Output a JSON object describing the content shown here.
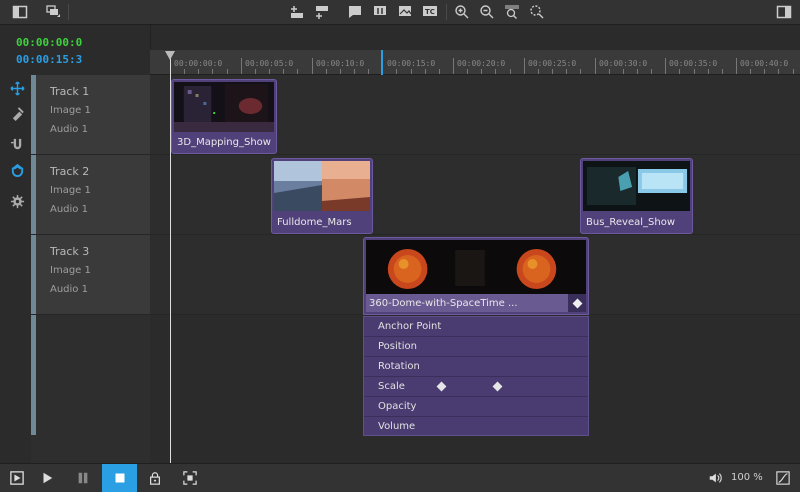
{
  "timecode": {
    "current": "00:00:00:0",
    "duration": "00:00:15:3"
  },
  "ruler": {
    "labels": [
      "00:00:00:0",
      "00:00:05:0",
      "00:00:10:0",
      "00:00:15:0",
      "00:00:20:0",
      "00:00:25:0",
      "00:00:30:0",
      "00:00:35:0",
      "00:00:40:0"
    ]
  },
  "tracks": [
    {
      "name": "Track 1",
      "image": "Image 1",
      "audio": "Audio 1"
    },
    {
      "name": "Track 2",
      "image": "Image 1",
      "audio": "Audio 1"
    },
    {
      "name": "Track 3",
      "image": "Image 1",
      "audio": "Audio 1"
    }
  ],
  "clips": {
    "mapping": "3D_Mapping_Show",
    "mars": "Fulldome_Mars",
    "bus": "Bus_Reveal_Show",
    "dome": "360-Dome-with-SpaceTime ..."
  },
  "properties": [
    "Anchor Point",
    "Position",
    "Rotation",
    "Scale",
    "Opacity",
    "Volume"
  ],
  "bottombar": {
    "zoom": "100 %"
  },
  "icons": {
    "top": [
      "panel-toggle-icon",
      "layers-icon",
      "add-track-above-icon",
      "add-track-below-icon",
      "marker-icon",
      "split-icon",
      "image-marker-icon",
      "timecode-icon",
      "zoom-in-icon",
      "zoom-out-icon",
      "zoom-fit-icon",
      "zoom-reset-icon",
      "panel-right-icon"
    ],
    "tools": [
      "move-icon",
      "razor-icon",
      "snap-magnet-icon",
      "magnet-icon",
      "settings-gear-icon"
    ]
  }
}
